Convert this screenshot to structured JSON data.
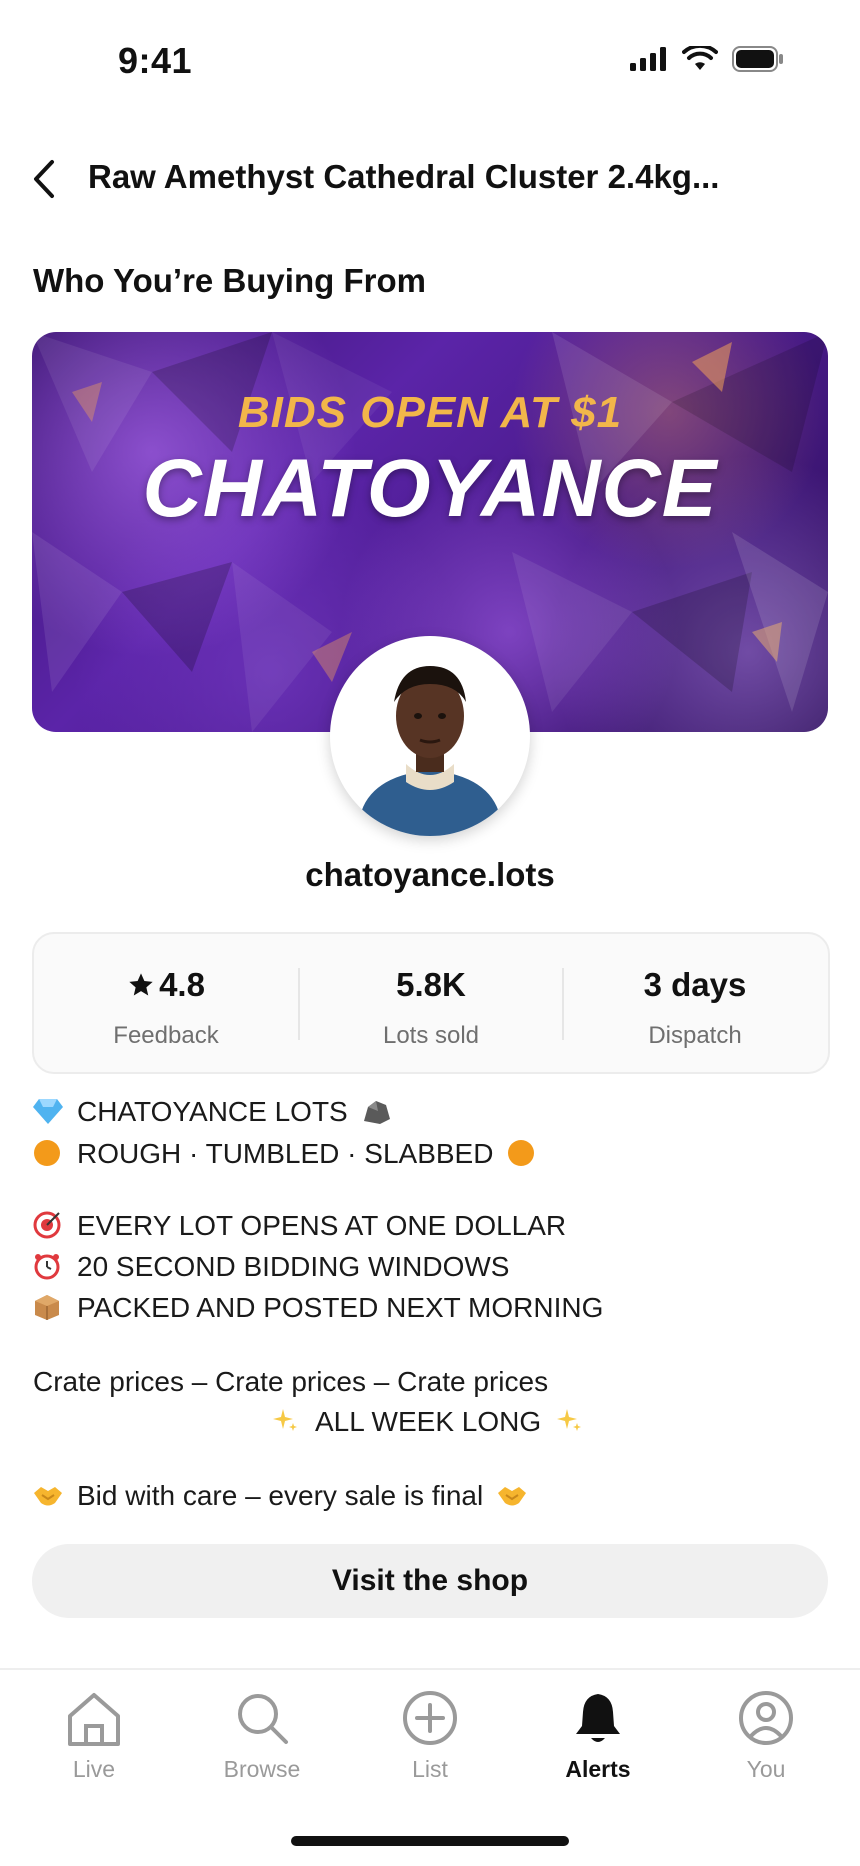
{
  "status_bar": {
    "time": "9:41",
    "icons": [
      "signal-icon",
      "wifi-icon",
      "battery-icon"
    ]
  },
  "header": {
    "back_icon": "chevron-left-icon",
    "title": "Raw Amethyst Cathedral Cluster 2.4kg..."
  },
  "section": {
    "title": "Who You’re Buying From"
  },
  "banner": {
    "tagline": "BIDS OPEN AT $1",
    "name": "CHATOYANCE",
    "tagline_color": "#f2b64a"
  },
  "seller": {
    "username": "chatoyance.lots",
    "stats": [
      {
        "value": "4.8",
        "icon": "star-icon",
        "label": "Feedback"
      },
      {
        "value": "5.8K",
        "label": "Lots sold"
      },
      {
        "value": "3 days",
        "label": "Dispatch"
      }
    ]
  },
  "bio": {
    "lines": [
      {
        "emoji": "gem-icon",
        "text": "CHATOYANCE LOTS"
      },
      {
        "emoji": "orange-circle-icon",
        "text": "ROUGH · TUMBLED · SLABBED"
      },
      {
        "emoji": "target-icon",
        "text": "EVERY LOT OPENS AT ONE DOLLAR"
      },
      {
        "emoji": "alarm-clock-icon",
        "text": "20 SECOND BIDDING WINDOWS"
      },
      {
        "emoji": "package-icon",
        "text": "PACKED AND POSTED NEXT MORNING"
      },
      {
        "text": "Crate prices – Crate prices – Crate prices"
      },
      {
        "emoji": "sparkles-icon",
        "text": "ALL WEEK LONG"
      },
      {
        "emoji": "handshake-icon",
        "text": "Bid with care – every sale is final"
      }
    ]
  },
  "actions": {
    "visit_shop": "Visit the shop"
  },
  "tabs": [
    {
      "label": "Live",
      "icon": "home-icon"
    },
    {
      "label": "Browse",
      "icon": "search-icon"
    },
    {
      "label": "List",
      "icon": "plus-circle-icon"
    },
    {
      "label": "Alerts",
      "icon": "bell-icon",
      "active": true
    },
    {
      "label": "You",
      "icon": "user-icon"
    }
  ]
}
